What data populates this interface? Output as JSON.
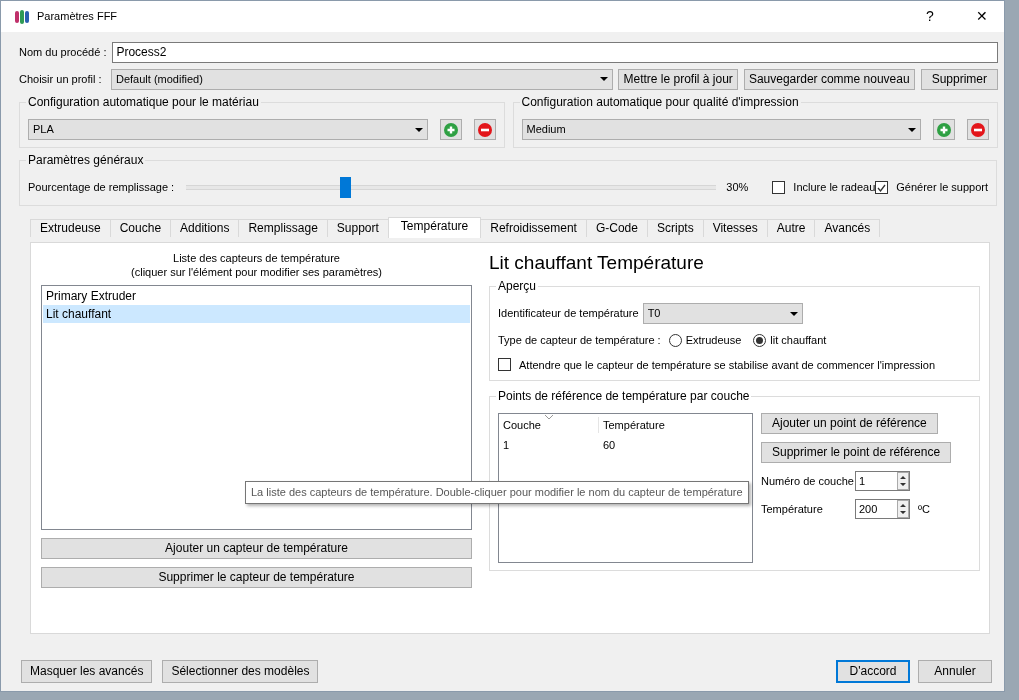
{
  "window": {
    "title": "Paramètres FFF",
    "title_buttons": [
      "?",
      "✕"
    ]
  },
  "process_name": {
    "label": "Nom du procédé :",
    "value": "Process2"
  },
  "profile": {
    "label": "Choisir un profil :",
    "value": "Default (modified)",
    "buttons": [
      "Mettre le profil à jour",
      "Sauvegarder comme nouveau",
      "Supprimer"
    ]
  },
  "auto_configs": [
    {
      "title": "Configuration automatique pour le matériau",
      "value": "PLA"
    },
    {
      "title": "Configuration automatique pour qualité d'impression",
      "value": "Medium"
    }
  ],
  "general": {
    "title": "Paramètres généraux",
    "infill_label": "Pourcentage de remplissage :",
    "level": 0.3,
    "reading": "30%",
    "checkboxes": [
      {
        "label": "Inclure le radeau",
        "checked": false
      },
      {
        "label": "Générer le support",
        "checked": true
      }
    ]
  },
  "tabs": [
    {
      "label": "Extrudeuse",
      "selected": false
    },
    {
      "label": "Couche",
      "selected": false
    },
    {
      "label": "Additions",
      "selected": false
    },
    {
      "label": "Remplissage",
      "selected": false
    },
    {
      "label": "Support",
      "selected": false
    },
    {
      "label": "Température",
      "selected": true
    },
    {
      "label": "Refroidissement",
      "selected": false
    },
    {
      "label": "G-Code",
      "selected": false
    },
    {
      "label": "Scripts",
      "selected": false
    },
    {
      "label": "Vitesses",
      "selected": false
    },
    {
      "label": "Autre",
      "selected": false
    },
    {
      "label": "Avancés",
      "selected": false
    }
  ],
  "sensors": {
    "title": "Liste des capteurs de température",
    "hint": "(cliquer sur l'élément pour modifier ses paramètres)",
    "items": [
      {
        "label": "Primary Extruder",
        "selected": false
      },
      {
        "label": "Lit chauffant",
        "selected": true
      }
    ],
    "buttons": [
      "Ajouter un capteur de température",
      "Supprimer le capteur de température"
    ]
  },
  "detail": {
    "heading": "Lit chauffant Température",
    "overview": {
      "title": "Aperçu",
      "id_label": "Identificateur de température",
      "id_value": "T0",
      "type_label": "Type de capteur de température :",
      "radios": [
        {
          "label": "Extrudeuse",
          "selected": false
        },
        {
          "label": "lit chauffant",
          "selected": true
        }
      ],
      "wait": {
        "label": "Attendre que le capteur de température se stabilise avant de commencer l'impression",
        "checked": false
      }
    },
    "points": {
      "title": "Points de référence de température par couche",
      "columns": [
        "Couche",
        "Température"
      ],
      "rows": [
        [
          "1",
          "60"
        ]
      ],
      "buttons": [
        "Ajouter un point de référence",
        "Supprimer le point de référence"
      ],
      "layer": {
        "label": "Numéro de couche",
        "value": "1"
      },
      "temperature": {
        "label": "Température",
        "value": "200",
        "unit": "ºC"
      }
    }
  },
  "tooltip": {
    "text": "La liste des capteurs de température. Double-cliquer pour modifier le nom du capteur de température"
  },
  "footer": {
    "left_buttons": [
      {
        "label": "Masquer les avancés",
        "default": false
      },
      {
        "label": "Sélectionner des modèles",
        "default": false
      }
    ],
    "right_buttons": [
      {
        "label": "D'accord",
        "default": true
      },
      {
        "label": "Annuler",
        "default": false
      }
    ]
  }
}
